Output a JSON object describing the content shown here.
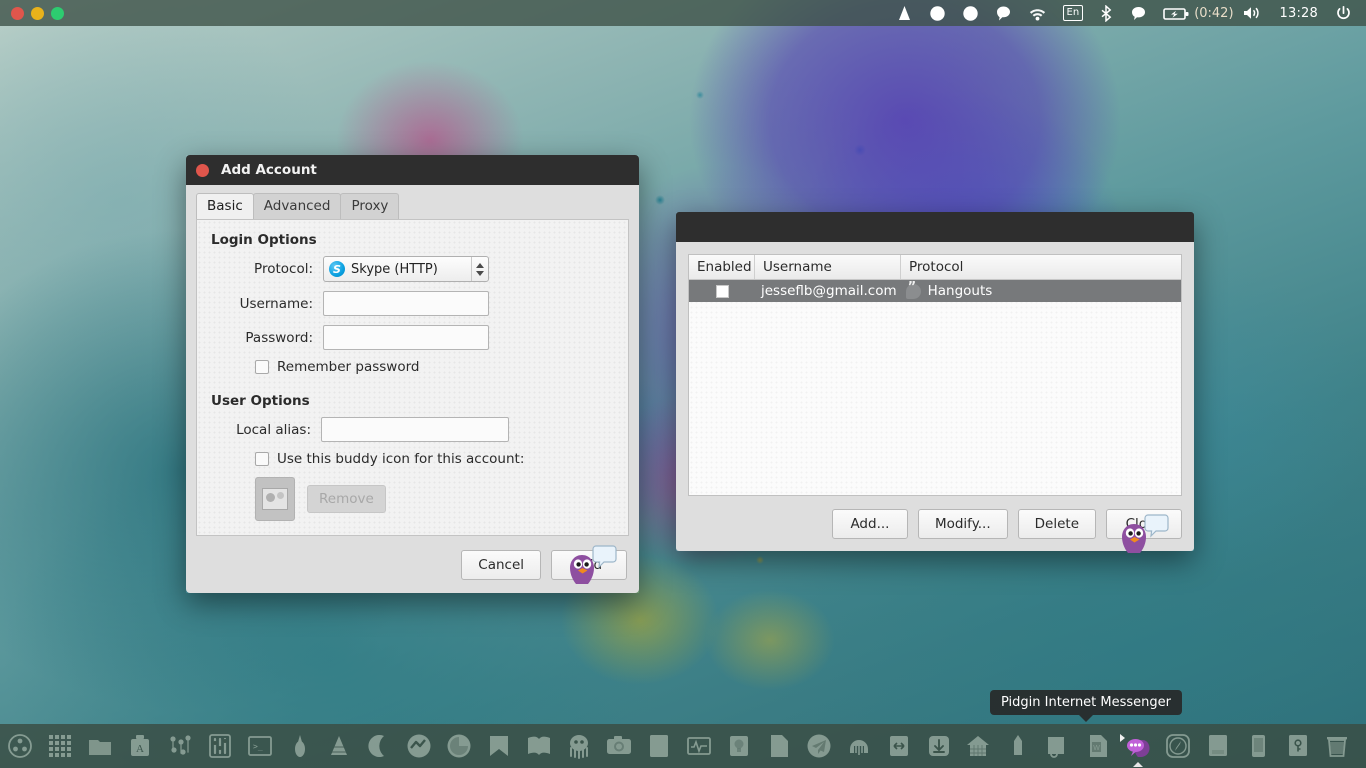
{
  "panel": {
    "window_controls": [
      "close",
      "minimize",
      "maximize"
    ],
    "indicators": [
      {
        "name": "cone-icon",
        "label": ""
      },
      {
        "name": "circle-indicator-icon",
        "label": ""
      },
      {
        "name": "circle-indicator-2-icon",
        "label": ""
      },
      {
        "name": "message-bubble-icon",
        "label": ""
      },
      {
        "name": "wifi-icon",
        "label": ""
      },
      {
        "name": "keyboard-layout-indicator",
        "label": "En"
      },
      {
        "name": "bluetooth-icon",
        "label": ""
      },
      {
        "name": "chat-bubble-icon",
        "label": ""
      },
      {
        "name": "battery-icon",
        "label": ""
      }
    ],
    "battery_time": "(0:42)",
    "volume_label": "",
    "clock": "13:28",
    "power_label": ""
  },
  "add_account": {
    "title": "Add Account",
    "tabs": [
      {
        "label": "Basic",
        "active": true
      },
      {
        "label": "Advanced",
        "active": false
      },
      {
        "label": "Proxy",
        "active": false
      }
    ],
    "login_options_title": "Login Options",
    "protocol_label": "Protocol:",
    "protocol_value": "Skype (HTTP)",
    "username_label": "Username:",
    "username_value": "",
    "password_label": "Password:",
    "password_value": "",
    "remember_password_label": "Remember password",
    "remember_password_checked": false,
    "user_options_title": "User Options",
    "local_alias_label": "Local alias:",
    "local_alias_value": "",
    "buddy_icon_label": "Use this buddy icon for this account:",
    "buddy_icon_checked": false,
    "remove_label": "Remove",
    "cancel_label": "Cancel",
    "add_label": "Add"
  },
  "accounts": {
    "title": "",
    "columns": [
      "Enabled",
      "Username",
      "Protocol"
    ],
    "rows": [
      {
        "enabled": false,
        "username": "jesseflb@gmail.com",
        "protocol": "Hangouts",
        "selected": true
      }
    ],
    "buttons": [
      "Add...",
      "Modify...",
      "Delete",
      "Close"
    ]
  },
  "tooltip": {
    "text": "Pidgin Internet Messenger"
  },
  "dock": {
    "items": [
      {
        "name": "ubuntu-dash-icon",
        "shape": "dash"
      },
      {
        "name": "applications-grid-icon",
        "shape": "grid"
      },
      {
        "name": "files-folder-icon",
        "shape": "folder"
      },
      {
        "name": "fonts-icon",
        "shape": "case"
      },
      {
        "name": "settings-dots-icon",
        "shape": "dots"
      },
      {
        "name": "audio-mixer-icon",
        "shape": "sliders"
      },
      {
        "name": "terminal-icon",
        "shape": "terminal"
      },
      {
        "name": "inkscape-icon",
        "shape": "pen"
      },
      {
        "name": "vlc-cone-icon",
        "shape": "cone"
      },
      {
        "name": "moon-icon",
        "shape": "moon"
      },
      {
        "name": "messenger-icon",
        "shape": "messenger"
      },
      {
        "name": "gimp-icon",
        "shape": "gimp"
      },
      {
        "name": "bookmark-icon",
        "shape": "bookmark"
      },
      {
        "name": "book-icon",
        "shape": "book"
      },
      {
        "name": "octopus-icon",
        "shape": "octopus"
      },
      {
        "name": "camera-icon",
        "shape": "camera"
      },
      {
        "name": "document-icon",
        "shape": "doc"
      },
      {
        "name": "system-monitor-icon",
        "shape": "monitor"
      },
      {
        "name": "notes-idea-icon",
        "shape": "bulb"
      },
      {
        "name": "text-file-icon",
        "shape": "page"
      },
      {
        "name": "telegram-icon",
        "shape": "telegram"
      },
      {
        "name": "audacity-icon",
        "shape": "audacity"
      },
      {
        "name": "transfer-icon",
        "shape": "transfer"
      },
      {
        "name": "download-icon",
        "shape": "download"
      },
      {
        "name": "home-icon",
        "shape": "home"
      },
      {
        "name": "pencil-icon",
        "shape": "pencil"
      },
      {
        "name": "presentation-icon",
        "shape": "present"
      },
      {
        "name": "word-document-icon",
        "shape": "word"
      },
      {
        "name": "pidgin-icon",
        "shape": "pidgin",
        "active": true,
        "running": true
      },
      {
        "name": "compass-browser-icon",
        "shape": "compass"
      },
      {
        "name": "notebook-icon",
        "shape": "notebook"
      },
      {
        "name": "phone-icon",
        "shape": "phone"
      },
      {
        "name": "keys-icon",
        "shape": "keys"
      },
      {
        "name": "trash-icon",
        "shape": "trash"
      }
    ]
  },
  "colors": {
    "titlebar": "#2e2e2e",
    "close_button": "#e0564c",
    "selected_row": "#77797b",
    "panel": "rgba(62,82,72,0.80)",
    "skype_blue": "#0aa0e0"
  }
}
